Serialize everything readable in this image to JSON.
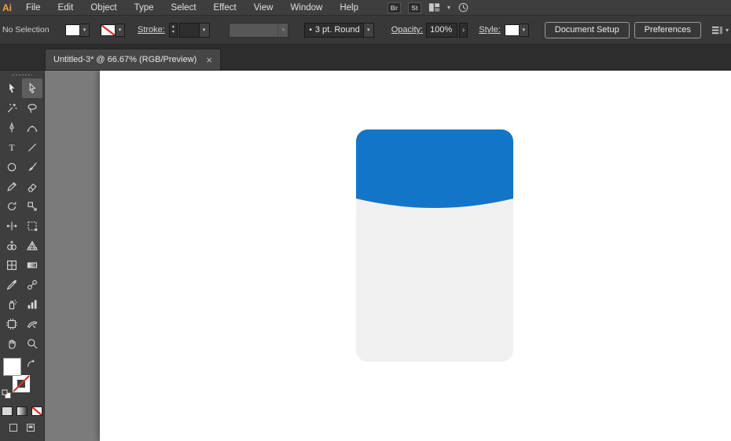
{
  "menu_bar": {
    "logo": "Ai",
    "items": [
      "File",
      "Edit",
      "Object",
      "Type",
      "Select",
      "Effect",
      "View",
      "Window",
      "Help"
    ],
    "right_buttons": [
      {
        "name": "bridge-button",
        "label": "Br"
      },
      {
        "name": "stock-button",
        "label": "St"
      },
      {
        "name": "arrange-documents-button",
        "icon": "arrange-documents"
      },
      {
        "name": "sync-settings-button",
        "icon": "sync-settings"
      }
    ]
  },
  "control_bar": {
    "selection_status": "No Selection",
    "stroke_label": "Stroke:",
    "stroke_weight": "",
    "brush_definition": "3 pt. Round",
    "opacity_label": "Opacity:",
    "opacity_value": "100%",
    "style_label": "Style:",
    "document_setup_button": "Document Setup",
    "preferences_button": "Preferences"
  },
  "tab_bar": {
    "active_tab": "Untitled-3* @ 66.67% (RGB/Preview)"
  },
  "toolbar": {
    "tools": [
      {
        "id": "selection",
        "active": false
      },
      {
        "id": "direct-selection",
        "active": true
      },
      {
        "id": "magic-wand"
      },
      {
        "id": "lasso"
      },
      {
        "id": "pen"
      },
      {
        "id": "curvature"
      },
      {
        "id": "type"
      },
      {
        "id": "line-segment"
      },
      {
        "id": "ellipse"
      },
      {
        "id": "paintbrush"
      },
      {
        "id": "pencil"
      },
      {
        "id": "eraser"
      },
      {
        "id": "rotate"
      },
      {
        "id": "scale"
      },
      {
        "id": "width"
      },
      {
        "id": "free-transform"
      },
      {
        "id": "shape-builder"
      },
      {
        "id": "perspective-grid"
      },
      {
        "id": "mesh"
      },
      {
        "id": "gradient"
      },
      {
        "id": "eyedropper"
      },
      {
        "id": "blend"
      },
      {
        "id": "symbol-sprayer"
      },
      {
        "id": "column-graph"
      },
      {
        "id": "artboard"
      },
      {
        "id": "slice"
      },
      {
        "id": "hand"
      },
      {
        "id": "zoom"
      }
    ],
    "fill_color": "#ffffff",
    "stroke_style": "none"
  },
  "canvas": {
    "shape": {
      "top_color": "#1375c8",
      "body_color": "#f0f0f0"
    }
  },
  "icons": {
    "chevron_down": "▾",
    "stepper_up": "▴",
    "stepper_down": "▾",
    "close": "×",
    "bullet": "•",
    "arrow_right": "›"
  },
  "colors": {
    "accent_blue": "#1375c8",
    "none_red": "#d9342b"
  }
}
